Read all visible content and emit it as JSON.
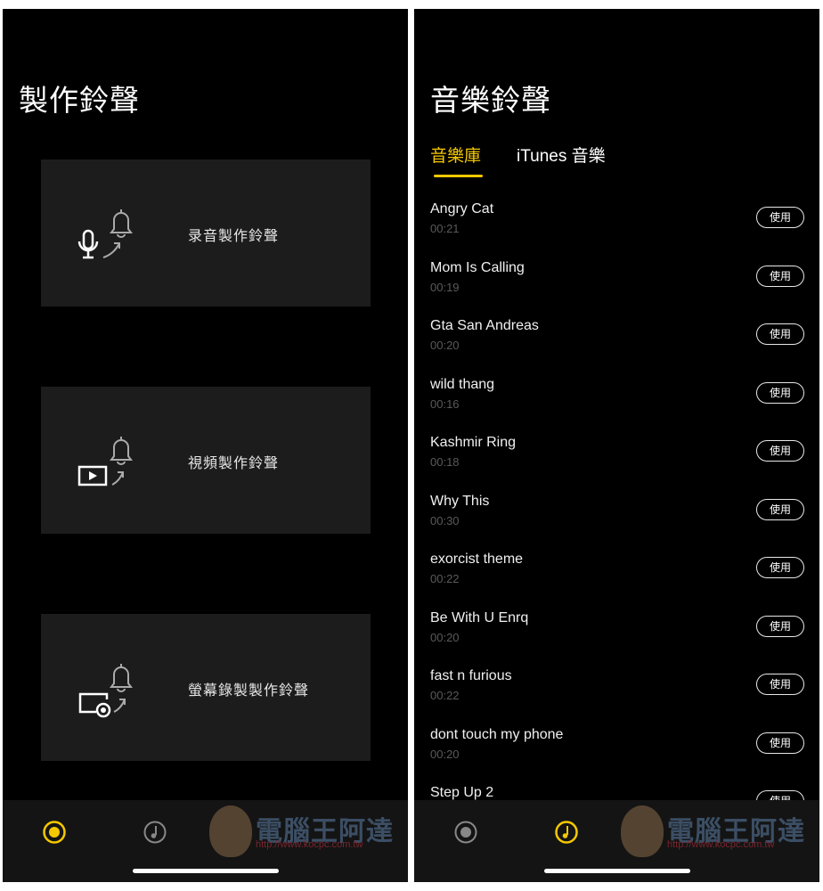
{
  "left": {
    "title": "製作鈴聲",
    "cards": [
      {
        "label": "录音製作鈴聲",
        "icon": "mic-to-bell-icon"
      },
      {
        "label": "視頻製作鈴聲",
        "icon": "video-to-bell-icon"
      },
      {
        "label": "螢幕錄製製作鈴聲",
        "icon": "screen-record-to-bell-icon"
      }
    ],
    "tabbar": {
      "active": "record",
      "items": [
        "record-icon",
        "music-note-icon"
      ]
    }
  },
  "right": {
    "title": "音樂鈴聲",
    "tabs": [
      {
        "label": "音樂庫",
        "active": true
      },
      {
        "label": "iTunes 音樂",
        "active": false
      }
    ],
    "use_label": "使用",
    "songs": [
      {
        "name": "Angry Cat",
        "duration": "00:21"
      },
      {
        "name": "Mom Is Calling",
        "duration": "00:19"
      },
      {
        "name": "Gta San Andreas",
        "duration": "00:20"
      },
      {
        "name": "wild thang",
        "duration": "00:16"
      },
      {
        "name": "Kashmir Ring",
        "duration": "00:18"
      },
      {
        "name": "Why This",
        "duration": "00:30"
      },
      {
        "name": "exorcist theme",
        "duration": "00:22"
      },
      {
        "name": "Be With U Enrq",
        "duration": "00:20"
      },
      {
        "name": "fast n furious",
        "duration": "00:22"
      },
      {
        "name": "dont touch my phone",
        "duration": "00:20"
      },
      {
        "name": "Step Up 2",
        "duration": ""
      }
    ],
    "tabbar": {
      "active": "music"
    }
  },
  "watermark": {
    "text": "電腦王阿達",
    "url": "http://www.kocpc.com.tw"
  },
  "colors": {
    "accent": "#f5c800",
    "background": "#000000",
    "card": "#1c1c1c",
    "tabbar": "#141414"
  }
}
